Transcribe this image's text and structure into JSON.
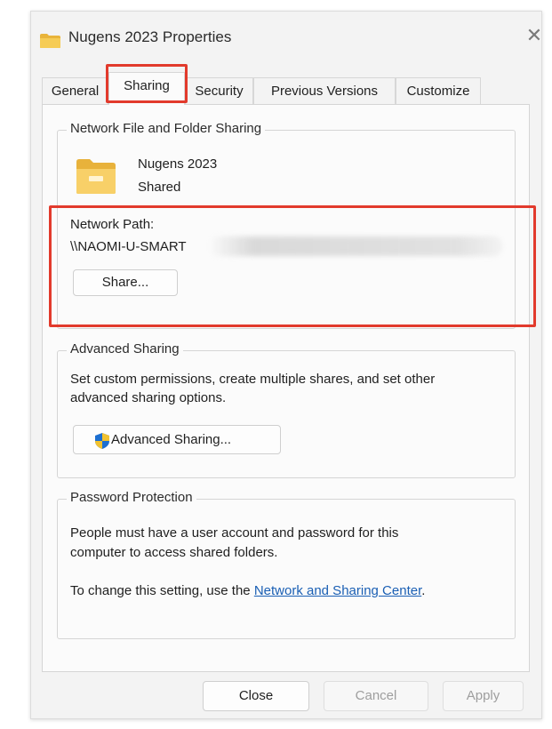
{
  "window": {
    "title": "Nugens 2023 Properties",
    "close_glyph": "✕"
  },
  "tabs": [
    {
      "label": "General",
      "active": false
    },
    {
      "label": "Sharing",
      "active": true
    },
    {
      "label": "Security",
      "active": false
    },
    {
      "label": "Previous Versions",
      "active": false
    },
    {
      "label": "Customize",
      "active": false
    }
  ],
  "network_sharing": {
    "group_title": "Network File and Folder Sharing",
    "folder_name": "Nugens 2023",
    "folder_status": "Shared",
    "path_label": "Network Path:",
    "path_value": "\\\\NAOMI-U-SMART",
    "share_button": "Share..."
  },
  "advanced_sharing": {
    "group_title": "Advanced Sharing",
    "description_line1": "Set custom permissions, create multiple shares, and set other",
    "description_line2": "advanced sharing options.",
    "button_label": "Advanced Sharing..."
  },
  "password_protection": {
    "group_title": "Password Protection",
    "line1": "People must have a user account and password for this",
    "line2": "computer to access shared folders.",
    "change_prefix": "To change this setting, use the ",
    "link_text": "Network and Sharing Center",
    "change_suffix": "."
  },
  "footer": {
    "close_label": "Close",
    "cancel_label": "Cancel",
    "apply_label": "Apply"
  },
  "colors": {
    "highlight": "#e23a2c",
    "link": "#1a5fb4",
    "folder": "#f4c64e"
  },
  "icons": {
    "title_icon": "folder-icon",
    "folder_icon": "shared-folder-icon",
    "shield": "uac-shield-icon"
  }
}
